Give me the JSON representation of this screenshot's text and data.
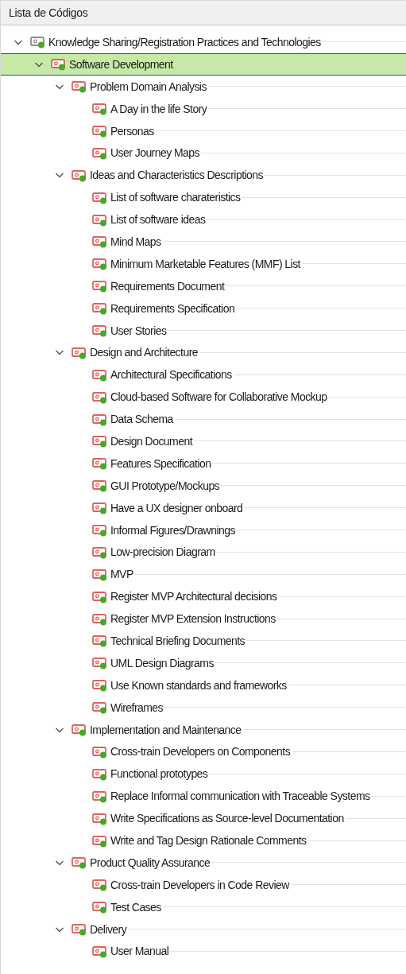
{
  "panel": {
    "title": "Lista de Códigos"
  },
  "tree": [
    {
      "label": "Knowledge Sharing/Registration Practices and Technologies",
      "color": "#8c8c8c",
      "selected": false,
      "expanded": true,
      "children": [
        {
          "label": "Software Development",
          "color": "#e0625a",
          "selected": true,
          "expanded": true,
          "children": [
            {
              "label": "Problem Domain Analysis",
              "color": "#e0625a",
              "selected": false,
              "expanded": true,
              "children": [
                {
                  "label": "A Day in the life Story",
                  "color": "#e0625a",
                  "selected": false
                },
                {
                  "label": "Personas",
                  "color": "#e0625a",
                  "selected": false
                },
                {
                  "label": "User Journey Maps",
                  "color": "#e0625a",
                  "selected": false
                }
              ]
            },
            {
              "label": "Ideas and Characteristics Descriptions",
              "color": "#e0625a",
              "selected": false,
              "expanded": true,
              "children": [
                {
                  "label": "List of software charateristics",
                  "color": "#e0625a",
                  "selected": false
                },
                {
                  "label": "List of software ideas",
                  "color": "#e0625a",
                  "selected": false
                },
                {
                  "label": "Mind Maps",
                  "color": "#e0625a",
                  "selected": false
                },
                {
                  "label": "Minimum Marketable Features (MMF) List",
                  "color": "#e0625a",
                  "selected": false
                },
                {
                  "label": "Requirements Document",
                  "color": "#e0625a",
                  "selected": false
                },
                {
                  "label": "Requirements Specification",
                  "color": "#e0625a",
                  "selected": false
                },
                {
                  "label": "User Stories",
                  "color": "#e0625a",
                  "selected": false
                }
              ]
            },
            {
              "label": "Design and Architecture",
              "color": "#e0625a",
              "selected": false,
              "expanded": true,
              "children": [
                {
                  "label": "Architectural Specifications",
                  "color": "#e0625a",
                  "selected": false
                },
                {
                  "label": "Cloud-based Software for Collaborative Mockup",
                  "color": "#e0625a",
                  "selected": false
                },
                {
                  "label": "Data Schema",
                  "color": "#e0625a",
                  "selected": false
                },
                {
                  "label": "Design Document",
                  "color": "#e0625a",
                  "selected": false
                },
                {
                  "label": "Features Specification",
                  "color": "#e0625a",
                  "selected": false
                },
                {
                  "label": "GUI Prototype/Mockups",
                  "color": "#e0625a",
                  "selected": false
                },
                {
                  "label": "Have a UX designer onboard",
                  "color": "#e0625a",
                  "selected": false
                },
                {
                  "label": "Informal Figures/Drawnings",
                  "color": "#e0625a",
                  "selected": false
                },
                {
                  "label": "Low-precision Diagram",
                  "color": "#e0625a",
                  "selected": false
                },
                {
                  "label": "MVP",
                  "color": "#e0625a",
                  "selected": false
                },
                {
                  "label": "Register MVP Architectural decisions",
                  "color": "#e0625a",
                  "selected": false
                },
                {
                  "label": "Register MVP Extension Instructions",
                  "color": "#e0625a",
                  "selected": false
                },
                {
                  "label": "Technical Briefing Documents",
                  "color": "#e0625a",
                  "selected": false
                },
                {
                  "label": "UML Design Diagrams",
                  "color": "#e0625a",
                  "selected": false
                },
                {
                  "label": "Use Known standards and frameworks",
                  "color": "#e0625a",
                  "selected": false
                },
                {
                  "label": "Wireframes",
                  "color": "#e0625a",
                  "selected": false
                }
              ]
            },
            {
              "label": "Implementation and Maintenance",
              "color": "#e0625a",
              "selected": false,
              "expanded": true,
              "children": [
                {
                  "label": "Cross-train Developers on Components",
                  "color": "#e0625a",
                  "selected": false
                },
                {
                  "label": "Functional prototypes",
                  "color": "#e0625a",
                  "selected": false
                },
                {
                  "label": "Replace Informal communication with Traceable Systems",
                  "color": "#e0625a",
                  "selected": false
                },
                {
                  "label": "Write Specifications as Source-level Documentation",
                  "color": "#e0625a",
                  "selected": false
                },
                {
                  "label": "Write and Tag Design Rationale Comments",
                  "color": "#e0625a",
                  "selected": false
                }
              ]
            },
            {
              "label": "Product Quality Assurance",
              "color": "#e0625a",
              "selected": false,
              "expanded": true,
              "children": [
                {
                  "label": "Cross-train Developers in Code Review",
                  "color": "#e0625a",
                  "selected": false
                },
                {
                  "label": "Test Cases",
                  "color": "#e0625a",
                  "selected": false
                }
              ]
            },
            {
              "label": "Delivery",
              "color": "#e0625a",
              "selected": false,
              "expanded": true,
              "children": [
                {
                  "label": "User Manual",
                  "color": "#e0625a",
                  "selected": false
                }
              ]
            }
          ]
        }
      ]
    }
  ]
}
